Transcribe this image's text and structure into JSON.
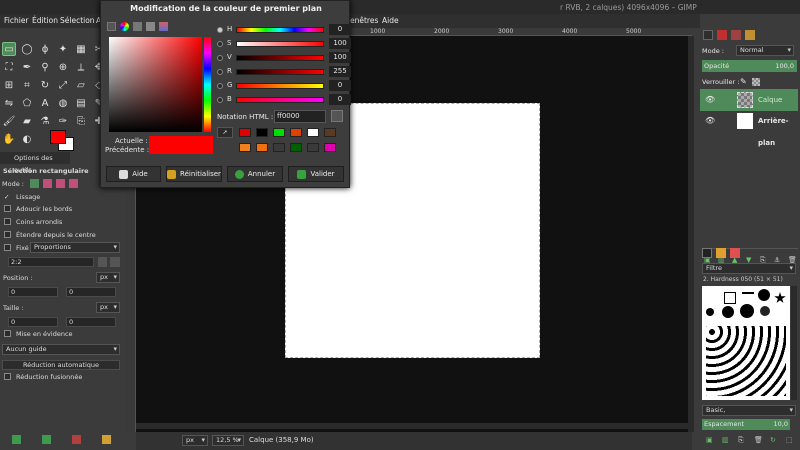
{
  "window": {
    "title": "r RVB, 2 calques) 4096x4096 – GIMP"
  },
  "menubar": {
    "items": [
      "Fichier",
      "Édition",
      "Sélection",
      "A",
      "enêtres",
      "Aide"
    ]
  },
  "toolbox": {
    "options_tab": "Options des outils",
    "tool_title": "Sélection rectangulaire",
    "mode_label": "Mode :",
    "antialias": "Lissage",
    "feather": "Adoucir les bords",
    "rounded": "Coins arrondis",
    "expand_center": "Étendre depuis le centre",
    "fixed_label": "Fixé :",
    "fixed_value": "Proportions",
    "ratio_value": "2:2",
    "position_label": "Position :",
    "position_unit": "px",
    "position_x": "0",
    "position_y": "0",
    "size_label": "Taille :",
    "size_unit": "px",
    "size_w": "0",
    "size_h": "0",
    "highlight": "Mise en évidence",
    "guides_value": "Aucun guide",
    "auto_shrink": "Réduction automatique",
    "shrink_merged": "Réduction fusionnée"
  },
  "dialog": {
    "title": "Modification de la couleur de premier plan",
    "current_label": "Actuelle :",
    "previous_label": "Précédente :",
    "html_label": "Notation HTML :",
    "html_value": "ff0000",
    "sliders": [
      {
        "label": "H",
        "value": "0"
      },
      {
        "label": "S",
        "value": "100"
      },
      {
        "label": "V",
        "value": "100"
      },
      {
        "label": "R",
        "value": "255"
      },
      {
        "label": "G",
        "value": "0"
      },
      {
        "label": "B",
        "value": "0"
      }
    ],
    "buttons": {
      "help": "Aide",
      "reset": "Réinitialiser",
      "cancel": "Annuler",
      "ok": "Valider"
    },
    "colors": {
      "current": "#ff0000",
      "previous": "#ff0000"
    }
  },
  "rulers": {
    "top": [
      "1000",
      "2000",
      "3000",
      "4000",
      "5000"
    ]
  },
  "statusbar": {
    "unit": "px",
    "zoom": "12,5 %",
    "info": "Calque (358,9 Mo)"
  },
  "dock": {
    "mode_label": "Mode :",
    "mode_value": "Normal",
    "opacity_label": "Opacité",
    "opacity_value": "100,0",
    "lock_label": "Verrouiller :",
    "layers": [
      {
        "name": "Calque"
      },
      {
        "name": "Arrière-plan"
      }
    ],
    "brush_filter": "Filtre",
    "brush_name": "2. Hardness 050 (51 × 51)",
    "brush_tag": "Basic,",
    "spacing_label": "Espacement",
    "spacing_value": "10,0"
  }
}
